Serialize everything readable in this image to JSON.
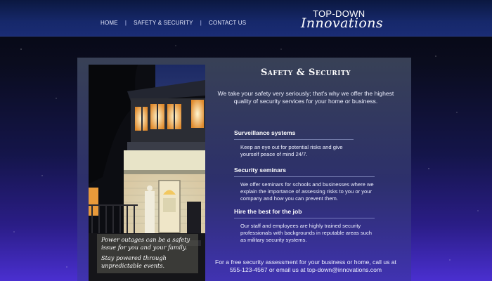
{
  "nav": {
    "items": [
      "HOME",
      "SAFETY & SECURITY",
      "CONTACT US"
    ],
    "separator": "|"
  },
  "logo": {
    "line1": "TOP-DOWN",
    "line2": "Innovations"
  },
  "page": {
    "title": "Safety & Security",
    "intro": "We take your safety very seriously; that's why we offer the highest quality of security services for your home or business."
  },
  "services": [
    {
      "title": "Surveillance systems",
      "desc": "Keep an eye out for potential risks and give yourself peace of mind 24/7."
    },
    {
      "title": "Security seminars",
      "desc": "We offer seminars for schools and businesses where we explain the importance of assessing risks to you or your company and how you can prevent them."
    },
    {
      "title": "Hire the best for the job",
      "desc": "Our staff and employees are highly trained security professionals with backgrounds in reputable areas such as military security systems."
    }
  ],
  "caption": {
    "line1": "Power outages can be a safety issue for you and your family.",
    "line2": "Stay powered through unpredictable events."
  },
  "cta": "For a free security assessment for your business or home, call us at 555-123-4567 or email us at top-down@innovations.com",
  "colors": {
    "header": "#16286a",
    "background_top": "#05060f",
    "background_bottom": "#4a2fd0"
  }
}
